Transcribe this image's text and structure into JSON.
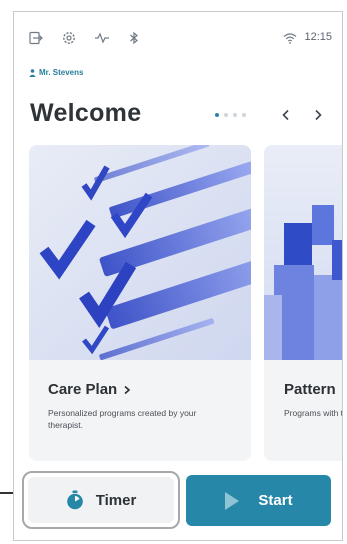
{
  "status": {
    "time": "12:15",
    "icons": [
      "logout-icon",
      "settings-icon",
      "activity-icon",
      "bluetooth-icon",
      "wifi-icon"
    ]
  },
  "user": {
    "name": "Mr. Stevens"
  },
  "page": {
    "title": "Welcome"
  },
  "carousel": {
    "page_count": 4,
    "active_index": 0,
    "cards": [
      {
        "title": "Care Plan",
        "description": "Personalized programs created by your therapist."
      },
      {
        "title": "Pattern",
        "description": "Programs with type and cha"
      }
    ]
  },
  "actions": {
    "timer_label": "Timer",
    "start_label": "Start"
  },
  "colors": {
    "accent": "#2787a8",
    "user_text": "#2a7f9a",
    "dot_active": "#2a86a6",
    "dot_inactive": "#cfd6da"
  }
}
